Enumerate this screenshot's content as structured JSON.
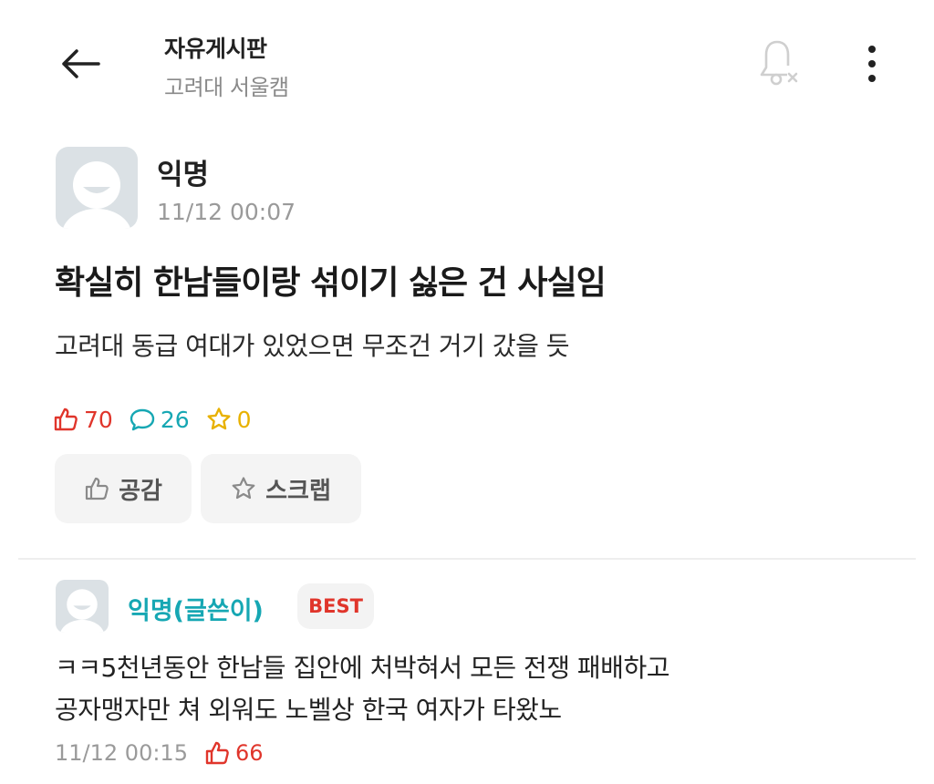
{
  "header": {
    "title": "자유게시판",
    "subtitle": "고려대 서울캠",
    "icons": {
      "back": "arrow-left-icon",
      "notify": "bell-off-icon",
      "more": "more-vertical-icon"
    }
  },
  "post": {
    "author": "익명",
    "time": "11/12 00:07",
    "title": "확실히 한남들이랑 섞이기 싫은 건 사실임",
    "body": "고려대 동급 여대가 있었으면 무조건 거기 갔을 듯",
    "likes": "70",
    "comments": "26",
    "scraps": "0"
  },
  "actions": {
    "like_label": "공감",
    "scrap_label": "스크랩"
  },
  "comment": {
    "author": "익명(글쓴이)",
    "badge": "BEST",
    "line1": "ㅋㅋ5천년동안 한남들 집안에 처박혀서 모든 전쟁 패배하고",
    "line2": "공자맹자만 쳐 외워도 노벨상 한국 여자가 타왔노",
    "time": "11/12 00:15",
    "likes": "66"
  },
  "colors": {
    "like": "#e0352b",
    "comment": "#16a7b3",
    "scrap": "#e8b100",
    "muted": "#9a9a9a"
  }
}
